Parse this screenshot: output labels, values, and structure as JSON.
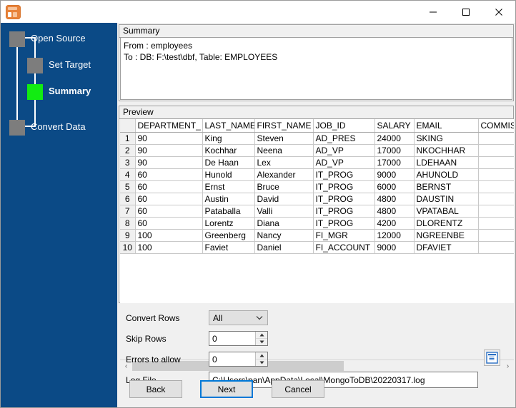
{
  "window": {
    "app_icon_name": "app-icon",
    "controls": {
      "minimize": "—",
      "maximize": "☐",
      "close": "✕"
    }
  },
  "sidebar": {
    "steps": [
      {
        "label": "Open Source",
        "state": "done"
      },
      {
        "label": "Set Target",
        "state": "done"
      },
      {
        "label": "Summary",
        "state": "active"
      },
      {
        "label": "Convert Data",
        "state": "pending"
      }
    ],
    "colors": {
      "background": "#0b4a86",
      "box_inactive": "#7d7d7d",
      "box_active": "#12ec12",
      "text": "#ffffff"
    }
  },
  "summary": {
    "caption": "Summary",
    "lines": [
      "From : employees",
      "To : DB: F:\\test\\dbf, Table: EMPLOYEES"
    ]
  },
  "preview": {
    "caption": "Preview",
    "columns": [
      "DEPARTMENT_",
      "LAST_NAME",
      "FIRST_NAME",
      "JOB_ID",
      "SALARY",
      "EMAIL",
      "COMMISS"
    ],
    "rows": [
      {
        "n": "1",
        "cells": [
          "90",
          "King",
          "Steven",
          "AD_PRES",
          "24000",
          "SKING",
          ""
        ]
      },
      {
        "n": "2",
        "cells": [
          "90",
          "Kochhar",
          "Neena",
          "AD_VP",
          "17000",
          "NKOCHHAR",
          ""
        ]
      },
      {
        "n": "3",
        "cells": [
          "90",
          "De Haan",
          "Lex",
          "AD_VP",
          "17000",
          "LDEHAAN",
          ""
        ]
      },
      {
        "n": "4",
        "cells": [
          "60",
          "Hunold",
          "Alexander",
          "IT_PROG",
          "9000",
          "AHUNOLD",
          ""
        ]
      },
      {
        "n": "5",
        "cells": [
          "60",
          "Ernst",
          "Bruce",
          "IT_PROG",
          "6000",
          "BERNST",
          ""
        ]
      },
      {
        "n": "6",
        "cells": [
          "60",
          "Austin",
          "David",
          "IT_PROG",
          "4800",
          "DAUSTIN",
          ""
        ]
      },
      {
        "n": "7",
        "cells": [
          "60",
          "Pataballa",
          "Valli",
          "IT_PROG",
          "4800",
          "VPATABAL",
          ""
        ]
      },
      {
        "n": "8",
        "cells": [
          "60",
          "Lorentz",
          "Diana",
          "IT_PROG",
          "4200",
          "DLORENTZ",
          ""
        ]
      },
      {
        "n": "9",
        "cells": [
          "100",
          "Greenberg",
          "Nancy",
          "FI_MGR",
          "12000",
          "NGREENBE",
          ""
        ]
      },
      {
        "n": "10",
        "cells": [
          "100",
          "Faviet",
          "Daniel",
          "FI_ACCOUNT",
          "9000",
          "DFAVIET",
          ""
        ]
      }
    ],
    "scrollbar": {
      "left_arrow": "‹",
      "right_arrow": "›"
    }
  },
  "form": {
    "convert_rows": {
      "label": "Convert Rows",
      "value": "All",
      "chevron": "˅"
    },
    "skip_rows": {
      "label": "Skip Rows",
      "value": "0"
    },
    "errors_to_allow": {
      "label": "Errors to allow",
      "value": "0"
    },
    "log_file": {
      "label": "Log File",
      "value": "C:\\Users\\pan\\AppData\\Local\\MongoToDB\\20220317.log",
      "browse_icon": "file-document-icon"
    },
    "spinner": {
      "up": "▲",
      "down": "▼"
    }
  },
  "footer": {
    "back": "Back",
    "next": "Next",
    "cancel": "Cancel",
    "default_button": "Next",
    "focus_color": "#0078d7"
  }
}
